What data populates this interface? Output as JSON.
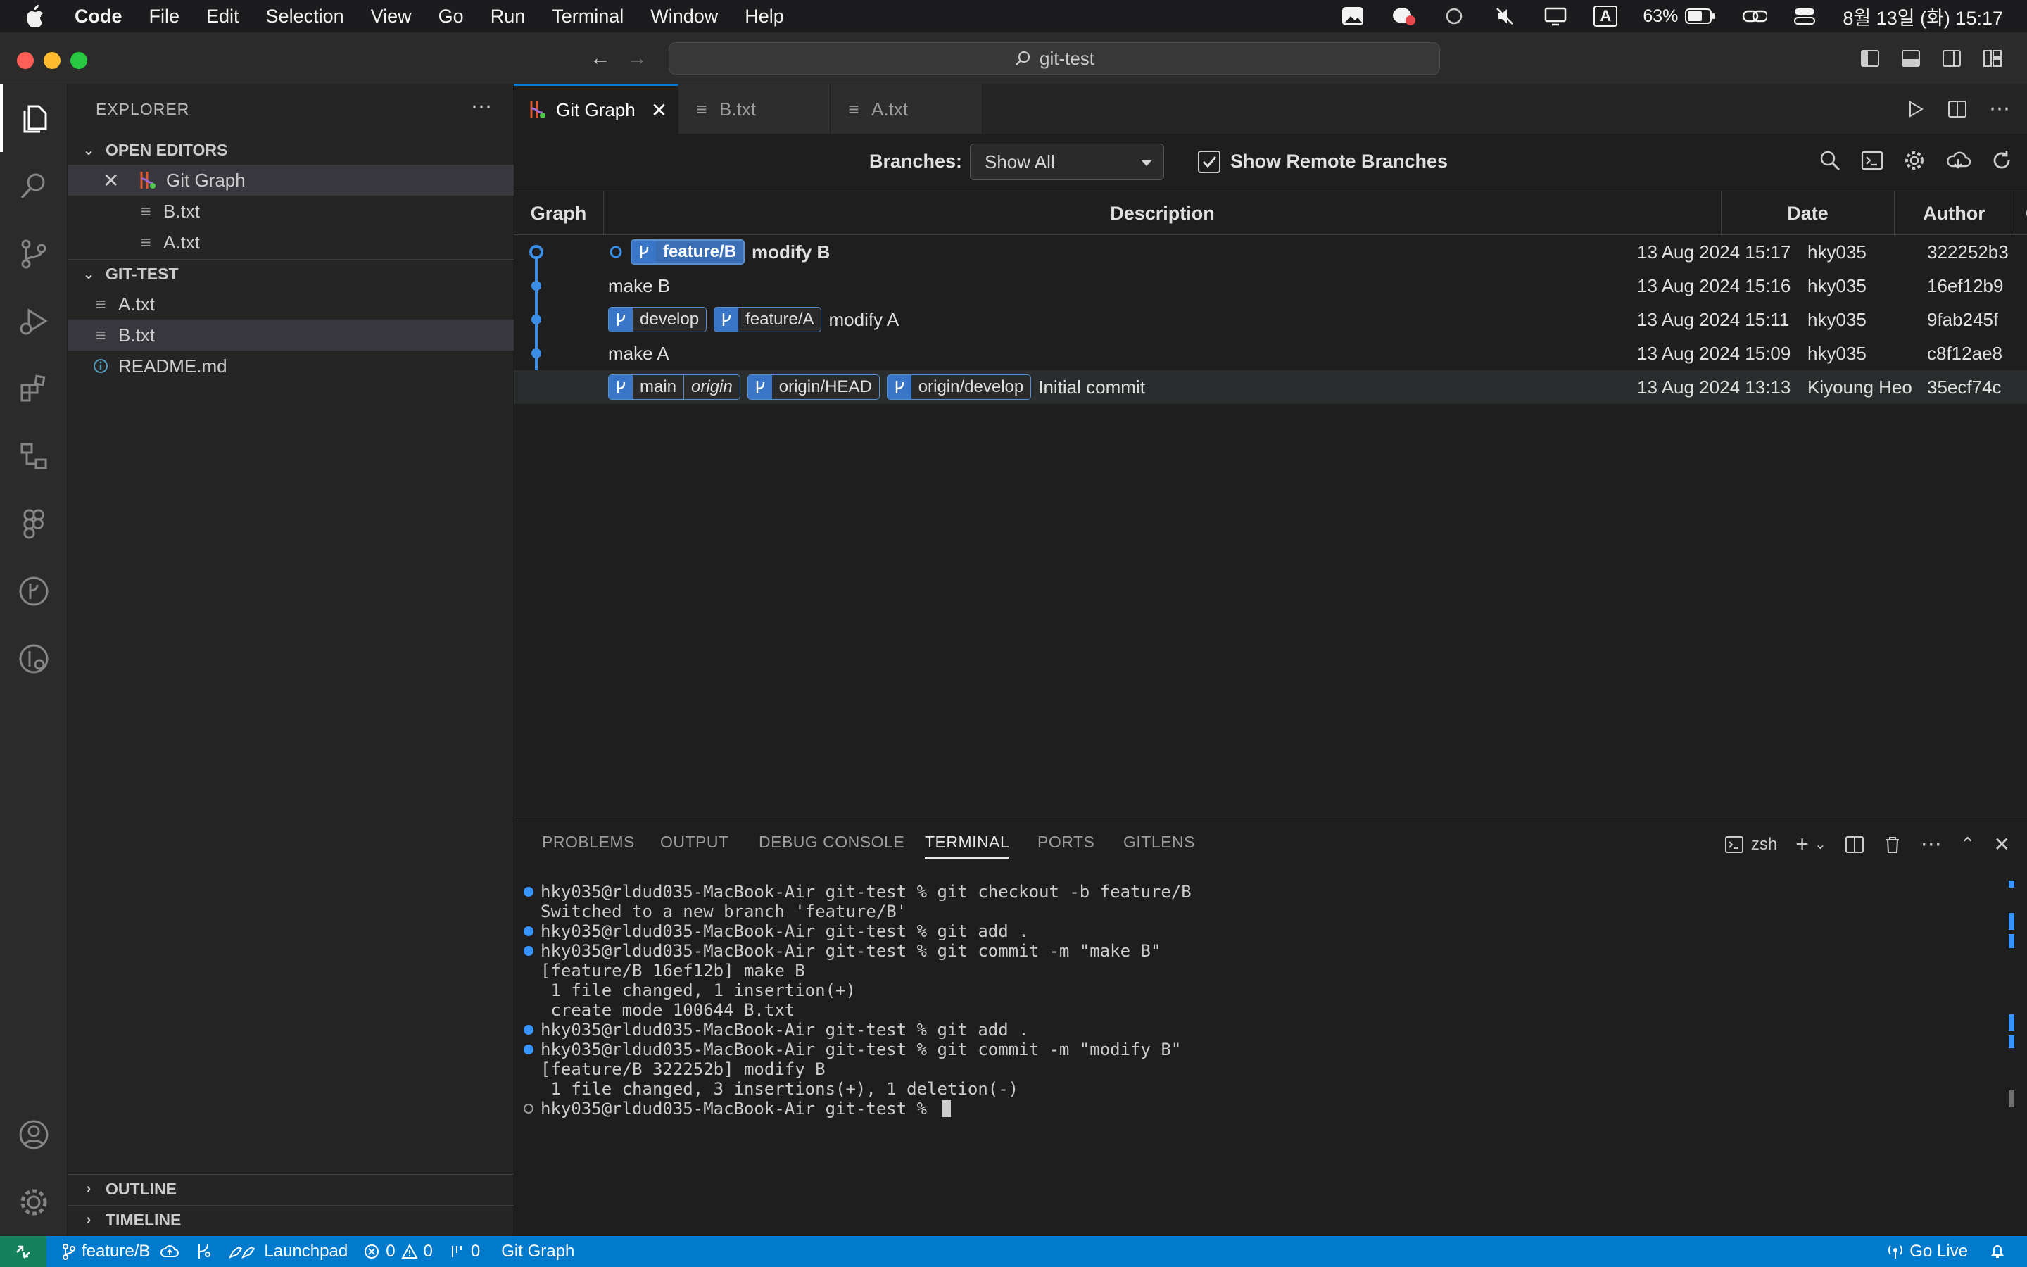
{
  "menubar": {
    "app": "Code",
    "items": [
      "File",
      "Edit",
      "Selection",
      "View",
      "Go",
      "Run",
      "Terminal",
      "Window",
      "Help"
    ],
    "battery": "63%",
    "clock": "8월 13일 (화) 15:17",
    "input_source": "A"
  },
  "window": {
    "command_center": "git-test"
  },
  "sidebar": {
    "title": "EXPLORER",
    "open_editors": {
      "header": "OPEN EDITORS",
      "items": [
        "Git Graph",
        "B.txt",
        "A.txt"
      ]
    },
    "folder": {
      "header": "GIT-TEST",
      "items": [
        "A.txt",
        "B.txt",
        "README.md"
      ]
    },
    "outline": "OUTLINE",
    "timeline": "TIMELINE"
  },
  "tabs": [
    {
      "label": "Git Graph",
      "active": true
    },
    {
      "label": "B.txt",
      "active": false
    },
    {
      "label": "A.txt",
      "active": false
    }
  ],
  "git_graph": {
    "branches_label": "Branches:",
    "branches_value": "Show All",
    "remote_label": "Show Remote Branches",
    "remote_checked": true,
    "columns": [
      "Graph",
      "Description",
      "Date",
      "Author",
      "Commit"
    ],
    "commits": [
      {
        "refs": [
          {
            "name": "feature/B",
            "head": true
          }
        ],
        "message": "modify B",
        "date": "13 Aug 2024 15:17",
        "author": "hky035",
        "hash": "322252b3"
      },
      {
        "refs": [],
        "message": "make B",
        "date": "13 Aug 2024 15:16",
        "author": "hky035",
        "hash": "16ef12b9"
      },
      {
        "refs": [
          {
            "name": "develop"
          },
          {
            "name": "feature/A"
          }
        ],
        "message": "modify A",
        "date": "13 Aug 2024 15:11",
        "author": "hky035",
        "hash": "9fab245f"
      },
      {
        "refs": [],
        "message": "make A",
        "date": "13 Aug 2024 15:09",
        "author": "hky035",
        "hash": "c8f12ae8"
      },
      {
        "refs": [
          {
            "name": "main",
            "remote": "origin"
          },
          {
            "name": "origin/HEAD"
          },
          {
            "name": "origin/develop"
          }
        ],
        "message": "Initial commit",
        "date": "13 Aug 2024 13:13",
        "author": "Kiyoung Heo",
        "hash": "35ecf74c"
      }
    ]
  },
  "panel": {
    "tabs": [
      "PROBLEMS",
      "OUTPUT",
      "DEBUG CONSOLE",
      "TERMINAL",
      "PORTS",
      "GITLENS"
    ],
    "active_tab": "TERMINAL",
    "shell": "zsh",
    "terminal_lines": [
      {
        "marker": "blue",
        "text": "hky035@rldud035-MacBook-Air git-test % git checkout -b feature/B"
      },
      {
        "marker": "none",
        "text": "Switched to a new branch 'feature/B'"
      },
      {
        "marker": "blue",
        "text": "hky035@rldud035-MacBook-Air git-test % git add ."
      },
      {
        "marker": "blue",
        "text": "hky035@rldud035-MacBook-Air git-test % git commit -m \"make B\""
      },
      {
        "marker": "none",
        "text": "[feature/B 16ef12b] make B"
      },
      {
        "marker": "none",
        "text": " 1 file changed, 1 insertion(+)"
      },
      {
        "marker": "none",
        "text": " create mode 100644 B.txt"
      },
      {
        "marker": "blue",
        "text": "hky035@rldud035-MacBook-Air git-test % git add ."
      },
      {
        "marker": "blue",
        "text": "hky035@rldud035-MacBook-Air git-test % git commit -m \"modify B\""
      },
      {
        "marker": "none",
        "text": "[feature/B 322252b] modify B"
      },
      {
        "marker": "none",
        "text": " 1 file changed, 3 insertions(+), 1 deletion(-)"
      },
      {
        "marker": "hollow",
        "text": "hky035@rldud035-MacBook-Air git-test % "
      }
    ]
  },
  "statusbar": {
    "branch": "feature/B",
    "launchpad": "Launchpad",
    "errors": "0",
    "warnings": "0",
    "ports": "0",
    "view": "Git Graph",
    "go_live": "Go Live"
  },
  "colors": {
    "accent": "#007acc",
    "graph_line": "#3a8ee6",
    "ref_badge": "#3976c7",
    "terminal_marker": "#3794ff"
  }
}
